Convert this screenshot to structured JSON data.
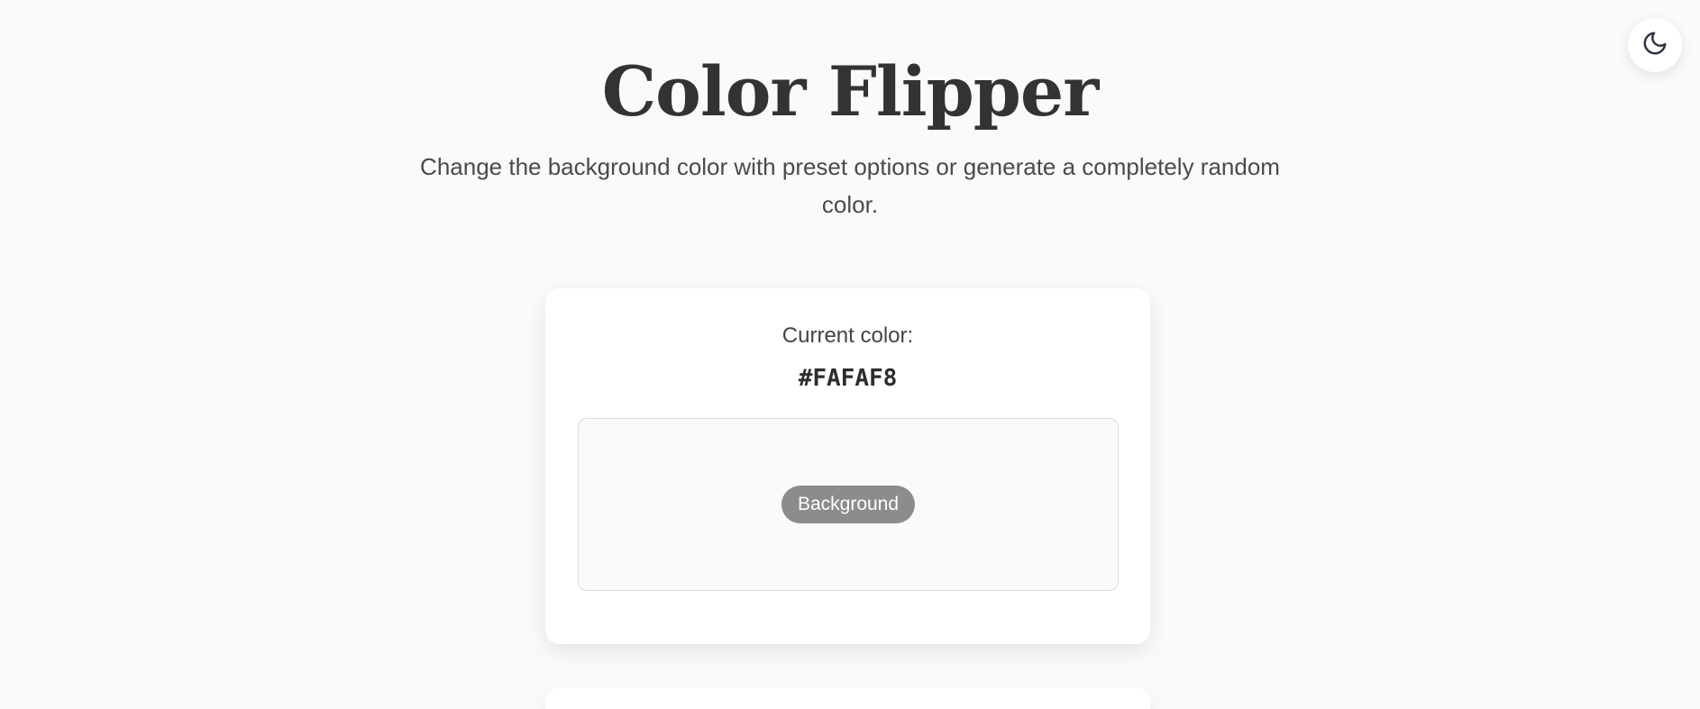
{
  "header": {
    "title": "Color Flipper",
    "subtitle": "Change the background color with preset options or generate a completely random color."
  },
  "theme_toggle": {
    "icon": "moon-icon"
  },
  "current_color": {
    "label": "Current color:",
    "hex": "#FAFAF8"
  },
  "preview": {
    "badge_label": "Background",
    "color": "#FAFAF8"
  },
  "colors": {
    "page_background": "#FAFAF8",
    "card_background": "#FFFFFF",
    "text_primary": "#333333",
    "badge_background": "#8C8C8C"
  }
}
